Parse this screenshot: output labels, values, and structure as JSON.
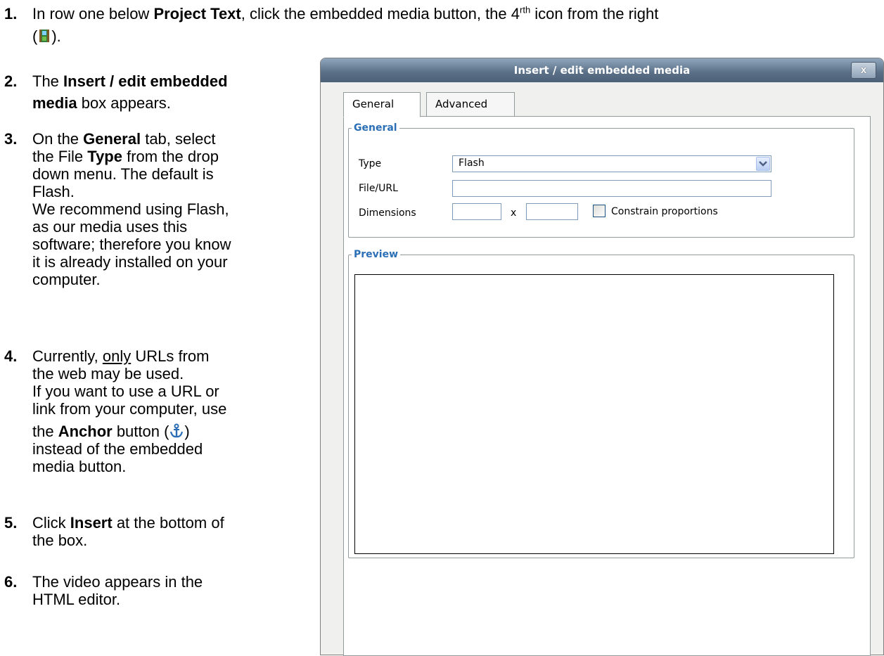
{
  "instructions": {
    "s1": {
      "num": "1.",
      "pre": "In row one below ",
      "bold": "Project Text",
      "mid": ", click the embedded media button, the 4",
      "sup": "rth",
      "post": " icon from the right",
      "paren_open": "(",
      "paren_close": ")."
    },
    "s2": {
      "num": "2.",
      "pre": "The ",
      "bold_l1": "Insert / edit embedded",
      "bold_l2": "media",
      "post": " box appears."
    },
    "s3": {
      "num": "3.",
      "pre": "On the ",
      "bold1": "General",
      "mid1": " tab, select",
      "l2_pre": "the File ",
      "bold2": "Type",
      "l2_post": " from the drop",
      "l3": "down menu. The default is",
      "l4": "Flash.",
      "l5": "We recommend using Flash,",
      "l6": "as our media uses this",
      "l7": "software; therefore you know",
      "l8": "it is already installed on your",
      "l9": "computer."
    },
    "s4": {
      "num": "4.",
      "pre": "Currently, ",
      "und": "only",
      "post": " URLs from",
      "l2": "the web may be used.",
      "l3": "If you want to use a URL or",
      "l4": "link from your computer, use",
      "l5_pre": "the ",
      "bold": "Anchor",
      "l5_mid": " button (",
      "l5_post": ")",
      "l6": "instead of the embedded",
      "l7": "media button."
    },
    "s5": {
      "num": "5.",
      "pre": "Click ",
      "bold": "Insert",
      "post": " at the bottom of",
      "l2": "the box."
    },
    "s6": {
      "num": "6.",
      "l1": "The video appears in the",
      "l2": "HTML editor."
    }
  },
  "dialog": {
    "title": "Insert / edit embedded media",
    "close_label": "x",
    "tabs": [
      {
        "label": "General",
        "active": true
      },
      {
        "label": "Advanced",
        "active": false
      }
    ],
    "general_legend": "General",
    "type_label": "Type",
    "type_value": "Flash",
    "file_label": "File/URL",
    "file_value": "",
    "dimensions_label": "Dimensions",
    "dimensions_sep": "x",
    "constrain_label": "Constrain proportions",
    "preview_legend": "Preview"
  },
  "colors": {
    "title_bar": "#5a6f86",
    "legend": "#2b6fb6"
  },
  "icons": [
    "embedded-media-icon",
    "anchor-icon",
    "chevron-down-icon",
    "close-icon"
  ]
}
